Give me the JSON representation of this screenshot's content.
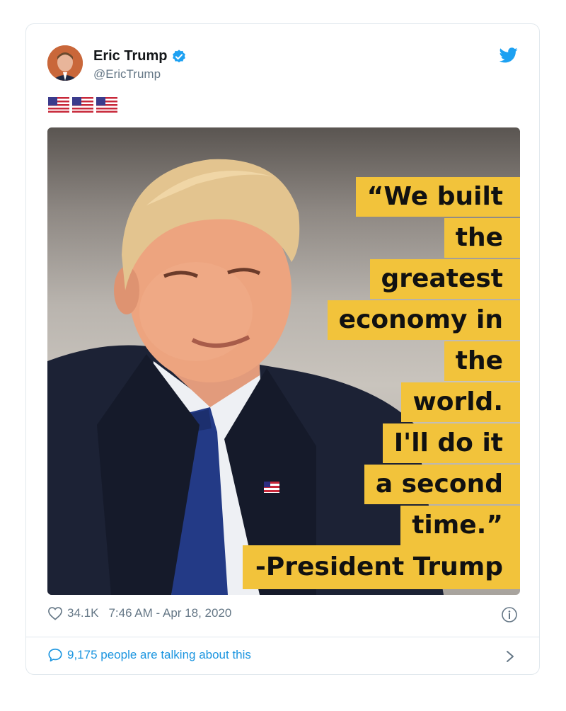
{
  "tweet": {
    "author_name": "Eric Trump",
    "author_handle": "@EricTrump",
    "verified": true,
    "text_emoji": "🇺🇸🇺🇸🇺🇸",
    "image": {
      "quote_lines": [
        "“We built",
        "the",
        "greatest",
        "economy in",
        "the",
        "world.",
        "I'll do it",
        "a second",
        "time.”"
      ],
      "attribution": "-President Trump",
      "highlight_color": "#f2c33b"
    },
    "likes": "34.1K",
    "timestamp": "7:46 AM - Apr 18, 2020",
    "conversation": "9,175 people are talking about this"
  },
  "icons": {
    "brand": "twitter-bird-icon",
    "verified": "verified-badge-icon",
    "like": "heart-icon",
    "info": "info-icon",
    "comment": "comment-bubble-icon",
    "chevron": "chevron-right-icon"
  },
  "colors": {
    "accent": "#1da1f2",
    "link": "#1b95e0",
    "muted": "#657786",
    "border": "#e1e8ed"
  }
}
